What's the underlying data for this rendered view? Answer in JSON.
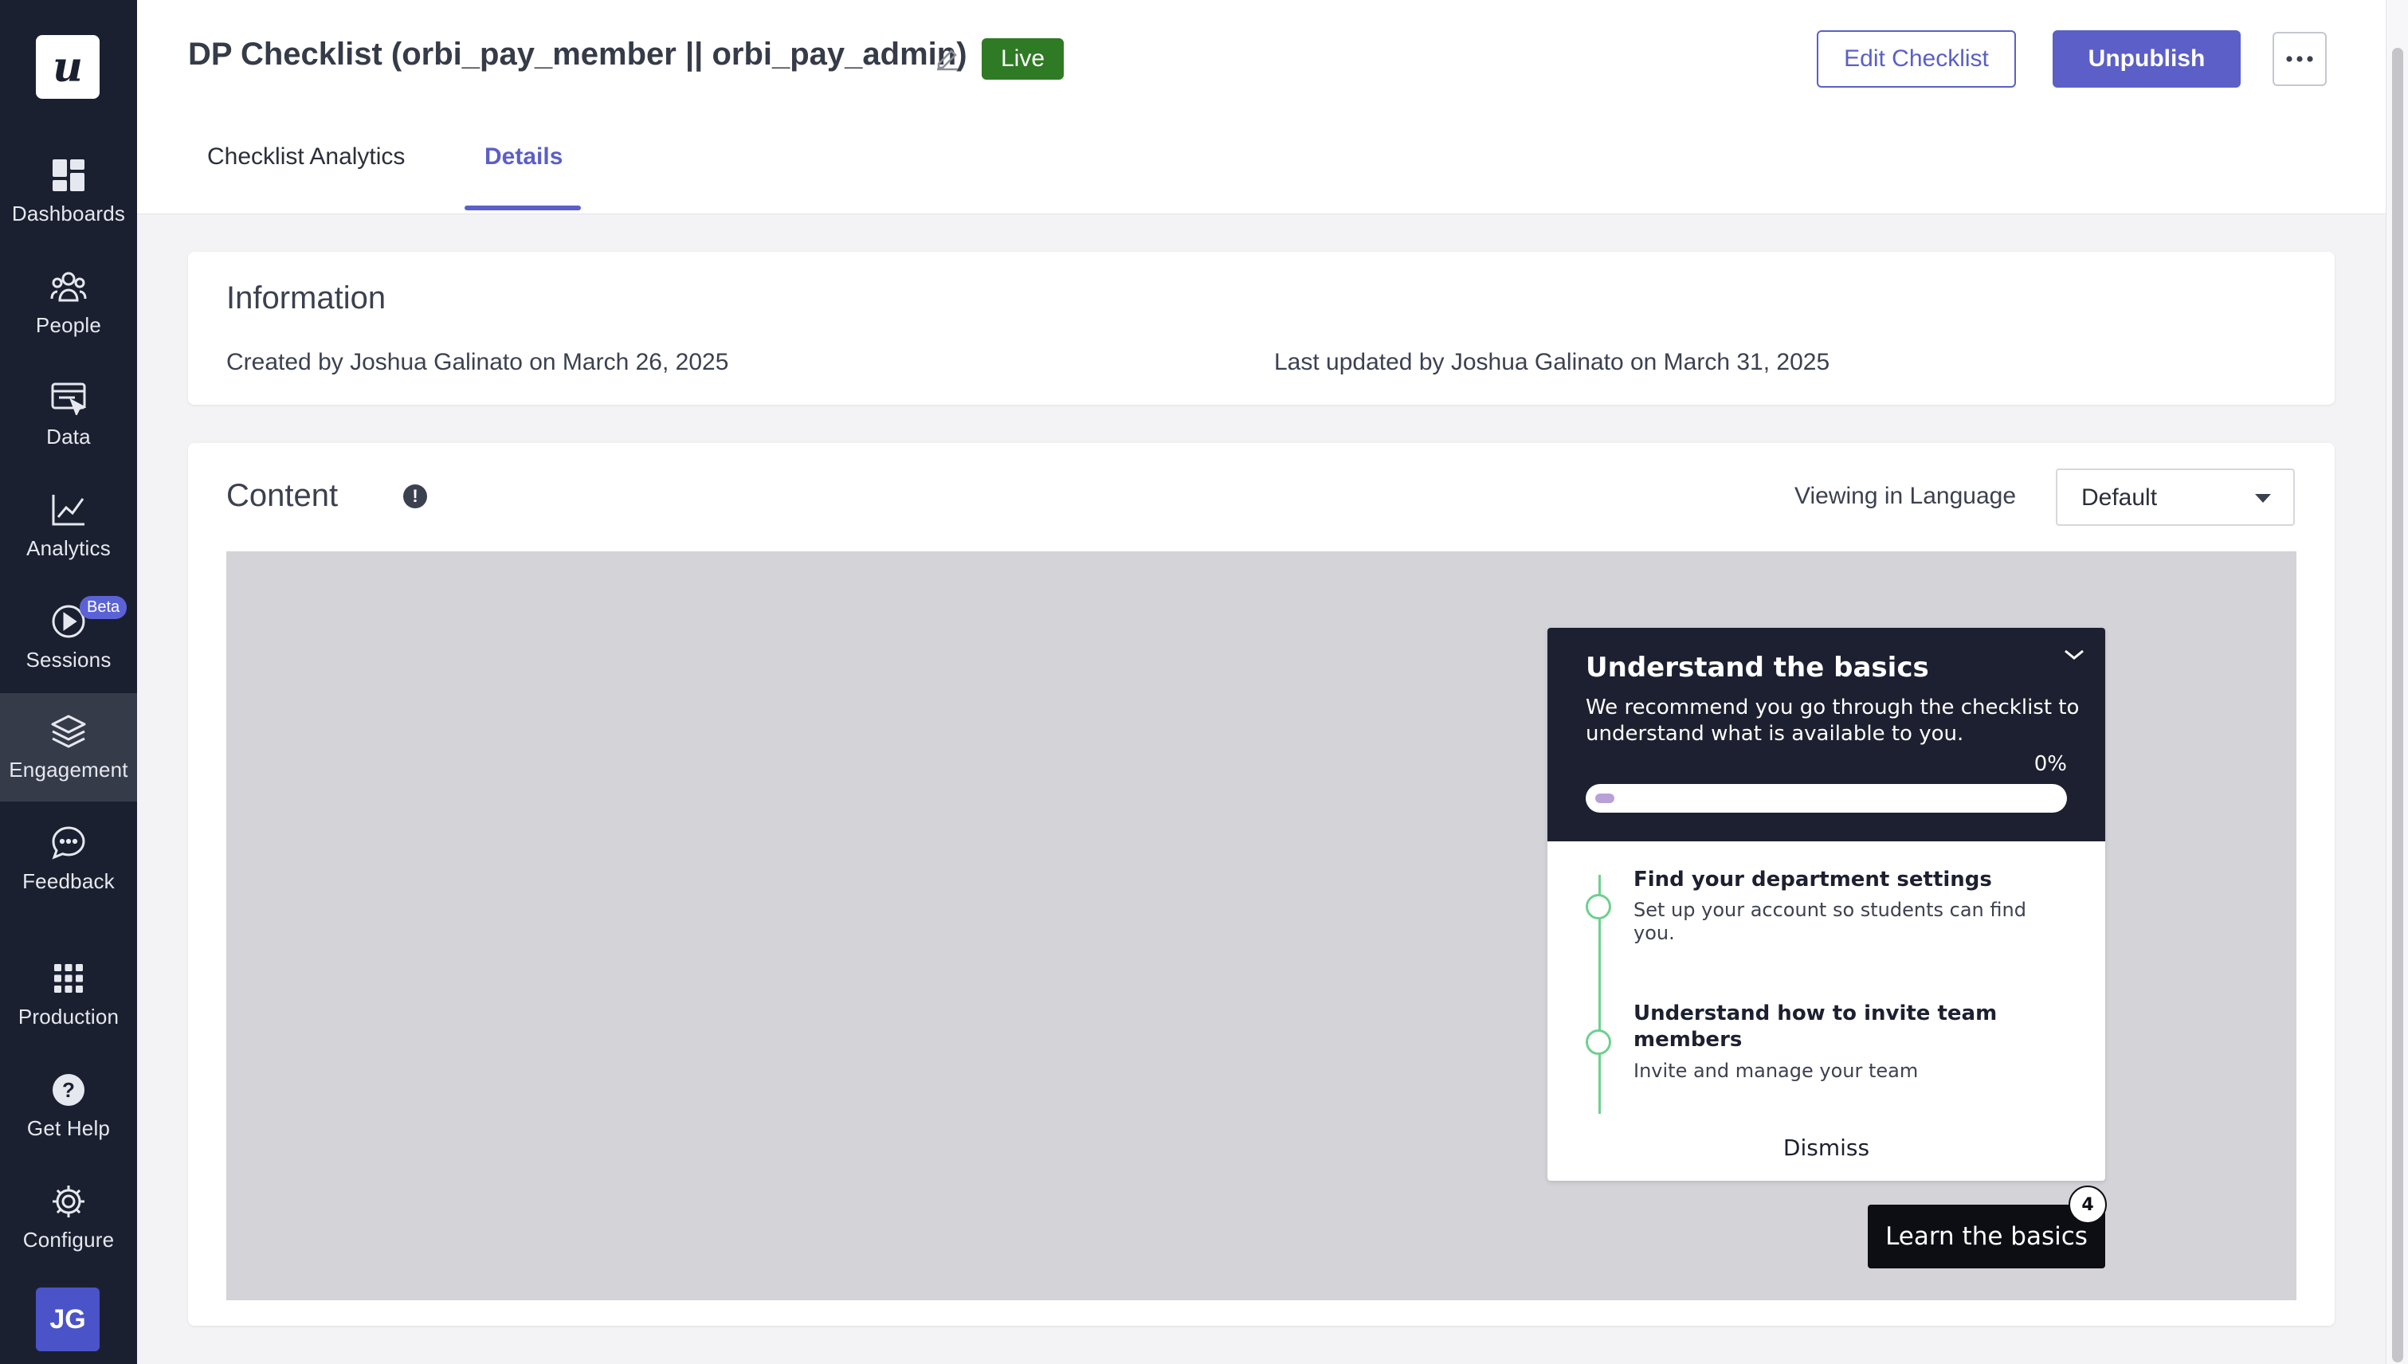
{
  "sidebar": {
    "logo_letter": "u",
    "items": [
      {
        "label": "Dashboards",
        "icon": "dashboards-icon"
      },
      {
        "label": "People",
        "icon": "people-icon"
      },
      {
        "label": "Data",
        "icon": "data-icon"
      },
      {
        "label": "Analytics",
        "icon": "analytics-icon"
      },
      {
        "label": "Sessions",
        "icon": "sessions-icon",
        "badge": "Beta"
      },
      {
        "label": "Engagement",
        "icon": "engagement-icon",
        "active": true
      },
      {
        "label": "Feedback",
        "icon": "feedback-icon"
      },
      {
        "label": "Production",
        "icon": "production-icon"
      },
      {
        "label": "Get Help",
        "icon": "help-icon"
      },
      {
        "label": "Configure",
        "icon": "configure-icon"
      }
    ],
    "avatar_initials": "JG"
  },
  "header": {
    "title": "DP Checklist (orbi_pay_member || orbi_pay_admin)",
    "status_badge": "Live",
    "edit_button": "Edit Checklist",
    "unpublish_button": "Unpublish",
    "tabs": [
      {
        "label": "Checklist Analytics",
        "active": false
      },
      {
        "label": "Details",
        "active": true
      }
    ]
  },
  "information": {
    "title": "Information",
    "created": "Created by Joshua Galinato on March 26, 2025",
    "updated": "Last updated by Joshua Galinato on March 31, 2025"
  },
  "content": {
    "title": "Content",
    "language_label": "Viewing in Language",
    "language_value": "Default"
  },
  "checklist_widget": {
    "title": "Understand the basics",
    "description": "We recommend you go through the checklist to understand what is available to you.",
    "progress_text": "0%",
    "progress_value": 0,
    "steps": [
      {
        "title": "Find your department settings",
        "description": "Set up your account so students can find you."
      },
      {
        "title": "Understand how to invite team members",
        "description": "Invite and manage your team"
      }
    ],
    "dismiss_label": "Dismiss",
    "launcher_label": "Learn the basics",
    "launcher_count": "4"
  },
  "colors": {
    "sidebar_bg": "#1b2030",
    "accent": "#5b5fc7",
    "live_badge": "#2f7a24",
    "widget_head": "#1d2030",
    "step_accent": "#6fd08f"
  }
}
